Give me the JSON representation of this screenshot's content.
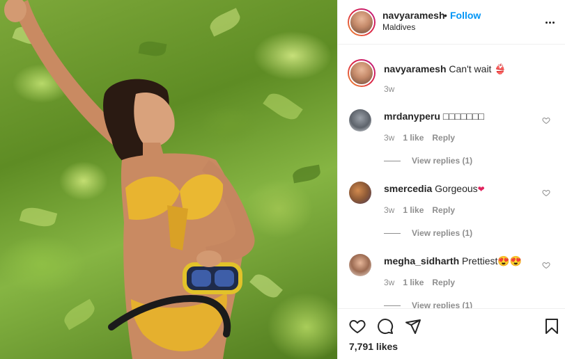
{
  "post": {
    "username": "navyaramesh",
    "separator": "•",
    "follow_label": "Follow",
    "location": "Maldives",
    "more_icon": "more-horizontal-icon"
  },
  "caption": {
    "username": "navyaramesh",
    "text": "Can't wait",
    "emoji": "👙",
    "time": "3w"
  },
  "comments": [
    {
      "username": "mrdanyperu",
      "text": "□□□□□□□",
      "time": "3w",
      "likes": "1 like",
      "reply": "Reply",
      "view_replies": "View replies (1)"
    },
    {
      "username": "smercedia",
      "text": "Gorgeous",
      "emoji": "❤",
      "time": "3w",
      "likes": "1 like",
      "reply": "Reply",
      "view_replies": "View replies (1)"
    },
    {
      "username": "megha_sidharth",
      "text": "Prettiest",
      "emoji": "😍😍",
      "time": "3w",
      "likes": "1 like",
      "reply": "Reply",
      "view_replies": "View replies (1)"
    }
  ],
  "actions": {
    "like_icon": "heart-icon",
    "comment_icon": "comment-icon",
    "share_icon": "share-icon",
    "save_icon": "bookmark-icon",
    "likes_count": "7,791 likes"
  },
  "colors": {
    "accent": "#0095f6",
    "text": "#262626",
    "muted": "#8e8e8e",
    "border": "#efefef"
  }
}
